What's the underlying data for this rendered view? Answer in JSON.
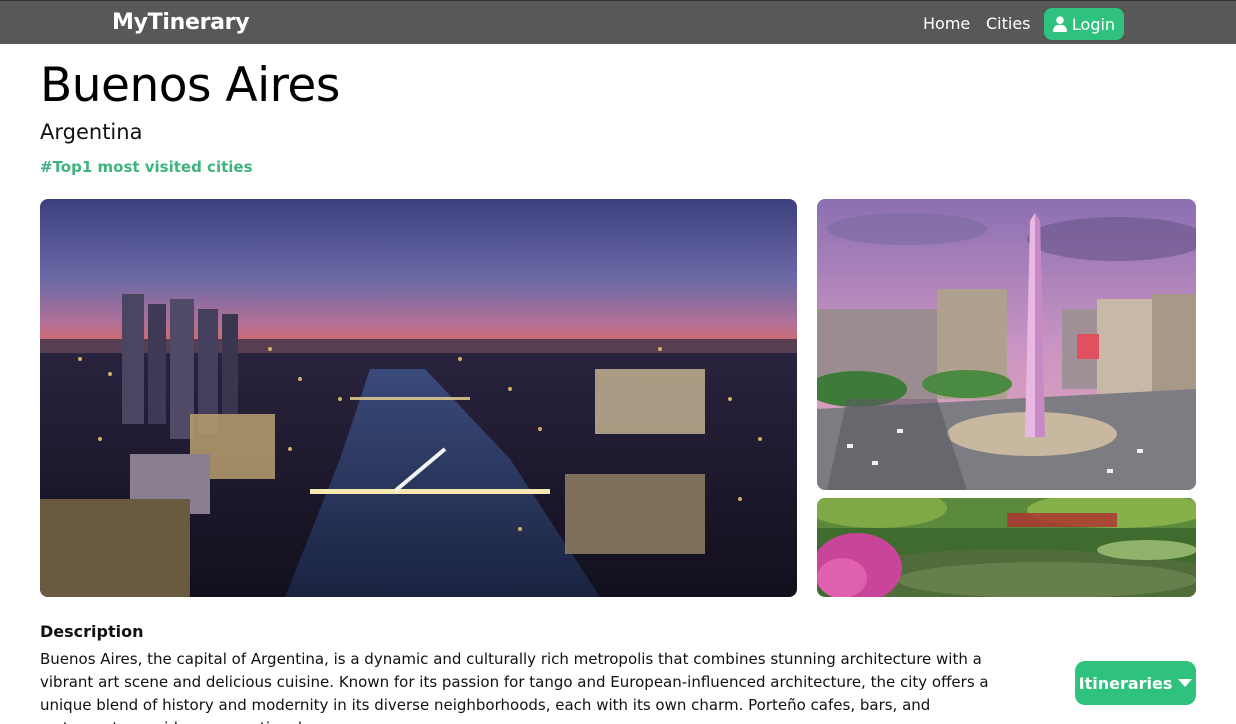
{
  "navbar": {
    "brand": "MyTinerary",
    "links": [
      "Home",
      "Cities"
    ],
    "login_label": "Login",
    "login_icon": "user-icon",
    "accent": "#2ec27e"
  },
  "city": {
    "name": "Buenos Aires",
    "country": "Argentina",
    "tagline": "#Top1 most visited cities"
  },
  "description": {
    "heading": "Description",
    "text": "Buenos Aires, the capital of Argentina, is a dynamic and culturally rich metropolis that combines stunning architecture with a vibrant art scene and delicious cuisine. Known for its passion for tango and European-influenced architecture, the city offers a unique blend of history and modernity in its diverse neighborhoods, each with its own charm. Porteño cafes, bars, and restaurants provide an exceptional"
  },
  "itineraries_button": {
    "label": "Itineraries",
    "icon": "caret-down-icon"
  }
}
